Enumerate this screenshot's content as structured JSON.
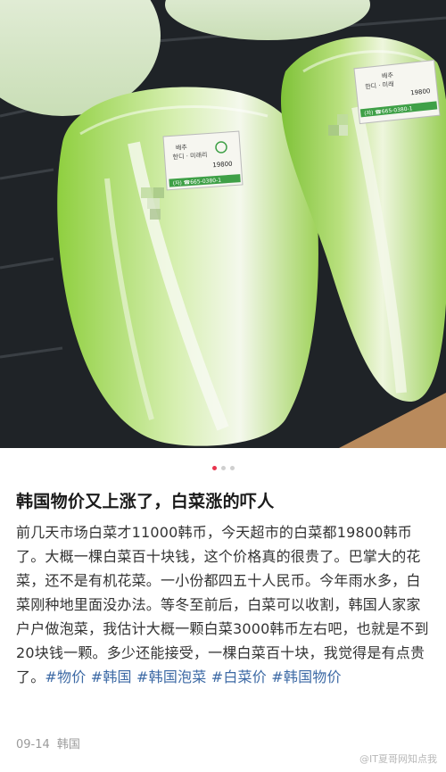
{
  "post": {
    "title": "韩国物价又上涨了，白菜涨的吓人",
    "body_text": "前几天市场白菜才11000韩币，今天超市的白菜都19800韩币了。大概一棵白菜百十块钱，这个价格真的很贵了。巴掌大的花菜，还不是有机花菜。一小份都四五十人民币。今年雨水多，白菜刚种地里面没办法。等冬至前后，白菜可以收割，韩国人家家户户做泡菜，我估计大概一颗白菜3000韩币左右吧，也就是不到20块钱一颗。多少还能接受，一棵白菜百十块，我觉得是有点贵了。",
    "hashtags": [
      "#物价",
      "#韩国",
      "#韩国泡菜",
      "#白菜价",
      "#韩国物价"
    ],
    "date": "09-14",
    "location": "韩国"
  },
  "carousel": {
    "total": 3,
    "active_index": 0,
    "active_color": "#e8344e"
  },
  "photo": {
    "description_icon": "cabbage-photo",
    "left_label": {
      "line1": "배추",
      "line2": "한디 · 미래리",
      "price": "19800",
      "code": "(자) ☎665-0380-1"
    },
    "right_label": {
      "line1": "배추",
      "line2": "한디 · 미래",
      "price": "19800",
      "code": "(자) ☎665-0380-1"
    }
  },
  "watermark": "@IT夏哥网知点我"
}
